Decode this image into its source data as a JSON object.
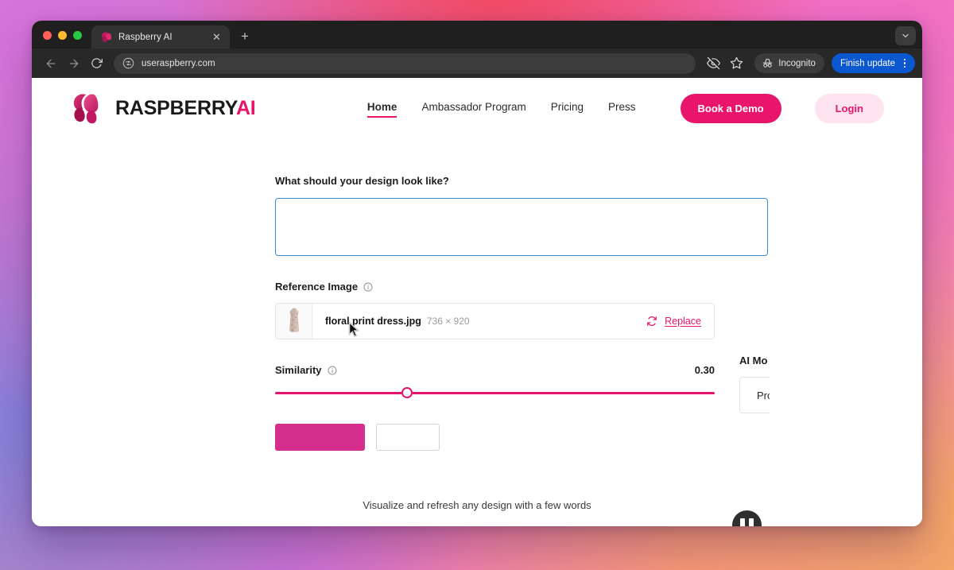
{
  "browser": {
    "tab": {
      "title": "Raspberry AI",
      "favicon_icon": "raspberry-logo-icon",
      "close_icon": "close-icon"
    },
    "new_tab_icon": "plus-icon",
    "tabstrip_chevron_icon": "chevron-down-icon",
    "toolbar": {
      "back_icon": "arrow-left-icon",
      "forward_icon": "arrow-right-icon",
      "reload_icon": "reload-icon",
      "site_settings_icon": "tune-icon",
      "url": "useraspberry.com",
      "hide_icon": "eye-slash-icon",
      "bookmark_icon": "star-icon",
      "incognito_icon": "incognito-hat-icon",
      "incognito_label": "Incognito",
      "update_label": "Finish update",
      "menu_icon": "kebab-menu-icon"
    }
  },
  "site": {
    "brand": {
      "mark_icon": "raspberry-mark-icon",
      "name_main": "RASPBERRY",
      "name_accent": "AI"
    },
    "nav": [
      {
        "label": "Home",
        "active": true
      },
      {
        "label": "Ambassador Program",
        "active": false
      },
      {
        "label": "Pricing",
        "active": false
      },
      {
        "label": "Press",
        "active": false
      }
    ],
    "cta_demo": "Book a Demo",
    "cta_login": "Login"
  },
  "tool": {
    "prompt": {
      "label": "What should your design look like?",
      "value": "",
      "placeholder": ""
    },
    "reference_image": {
      "label": "Reference Image",
      "info_icon": "info-circle-icon",
      "thumbnail_icon": "dress-thumbnail",
      "file_name": "floral print dress.jpg",
      "dimensions": "736 × 920",
      "replace_icon": "refresh-icon",
      "replace_label": "Replace"
    },
    "similarity": {
      "label": "Similarity",
      "info_icon": "info-circle-icon",
      "value": "0.30",
      "fraction": 30
    },
    "actions": {
      "primary_label": "",
      "secondary_label": ""
    },
    "ai_model": {
      "label": "AI Mo",
      "selected": "Pro"
    }
  },
  "overlay": {
    "pause_icon": "pause-icon",
    "caption": "Visualize and refresh any design with a few words",
    "cursor_icon": "mouse-pointer-icon"
  },
  "colors": {
    "brand_pink": "#e8156b",
    "button_magenta": "#d62e8d",
    "focus_blue": "#3d8ddd",
    "chrome_dark": "#282828",
    "update_blue": "#0b57d0"
  }
}
